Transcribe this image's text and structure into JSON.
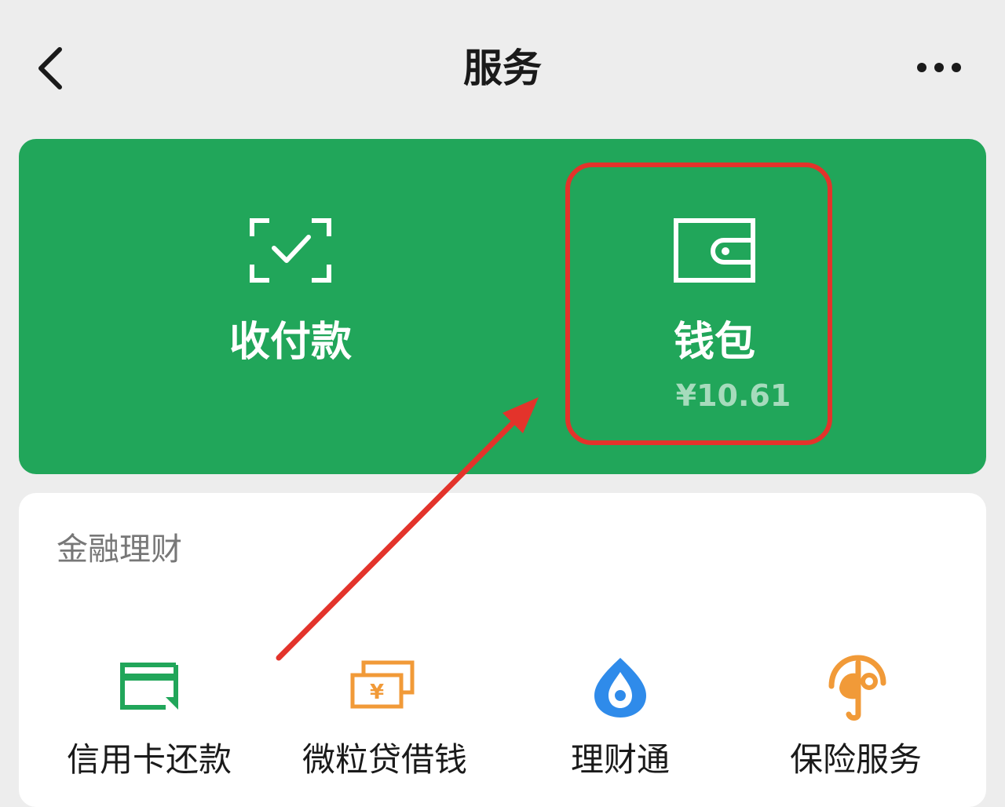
{
  "header": {
    "title": "服务",
    "back_icon": "chevron-left-icon",
    "more_icon": "more-dots-icon"
  },
  "payment_card": {
    "background_color": "#21a65a",
    "pay": {
      "label": "收付款",
      "icon": "scan-check-icon"
    },
    "wallet": {
      "label": "钱包",
      "balance": "¥10.61",
      "icon": "wallet-icon"
    }
  },
  "finance": {
    "section_title": "金融理财",
    "items": [
      {
        "label": "信用卡还款",
        "icon": "credit-card-repay-icon",
        "color": "#21a65a"
      },
      {
        "label": "微粒贷借钱",
        "icon": "yuan-banknote-icon",
        "color": "#f19a38"
      },
      {
        "label": "理财通",
        "icon": "wealth-drop-icon",
        "color": "#2f8bea"
      },
      {
        "label": "保险服务",
        "icon": "insurance-umbrella-icon",
        "color": "#f19a38"
      }
    ]
  },
  "annotation": {
    "highlight_color": "#e3332b"
  }
}
